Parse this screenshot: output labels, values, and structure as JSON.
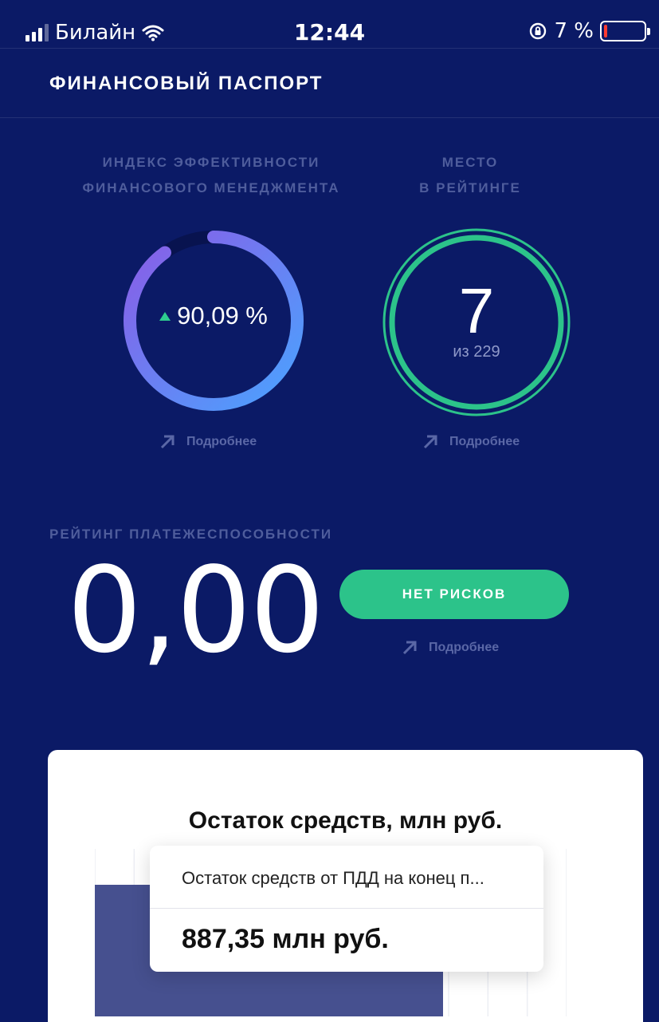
{
  "status_bar": {
    "carrier": "Билайн",
    "time": "12:44",
    "battery": "7 %",
    "battery_level": 0.07
  },
  "header": {
    "title": "ФИНАНСОВЫЙ ПАСПОРТ"
  },
  "efficiency": {
    "label_line1": "ИНДЕКС ЭФФЕКТИВНОСТИ",
    "label_line2": "ФИНАНСОВОГО МЕНЕДЖМЕНТА",
    "value": "90,09 %",
    "value_fraction": 0.9009,
    "more_label": "Подробнее"
  },
  "place": {
    "label_line1": "МЕСТО",
    "label_line2": "В РЕЙТИНГЕ",
    "value": "7",
    "total": "из 229",
    "more_label": "Подробнее"
  },
  "solvency": {
    "label": "РЕЙТИНГ ПЛАТЕЖЕСПОСОБНОСТИ",
    "value": "0,00",
    "badge": "НЕТ РИСКОВ",
    "more_label": "Подробнее"
  },
  "card": {
    "title": "Остаток средств, млн руб.",
    "tooltip": {
      "label": "Остаток средств от ПДД на конец п...",
      "value": "887,35 млн руб."
    }
  },
  "chart_data": {
    "type": "bar",
    "categories": [
      ""
    ],
    "values": [
      887.35
    ],
    "data_labels": [
      "887,35"
    ],
    "title": "Остаток средств, млн руб."
  },
  "colors": {
    "background": "#0b1a66",
    "accent_green": "#2cc38a",
    "gauge_start": "#4aa3ff",
    "gauge_end": "#8a5ce6",
    "bar": "#46508f"
  }
}
